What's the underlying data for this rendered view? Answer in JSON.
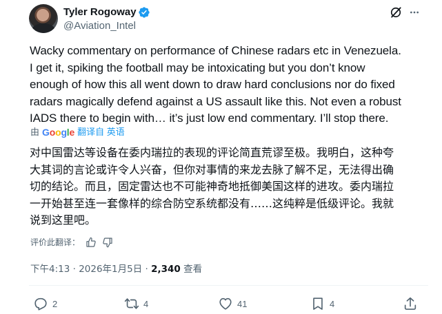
{
  "author": {
    "name": "Tyler Rogoway",
    "handle": "@Aviation_Intel",
    "verified": true,
    "verified_color": "#1d9bf0"
  },
  "tweet": {
    "lines": [
      "Wacky commentary on performance of Chinese radars etc in Venezuela.",
      "I get it, spiking the football may be intoxicating but you don’t know",
      "enough of how this all went down to draw hard conclusions nor do fixed",
      "radars magically defend against a US assault like this. Not even a robust",
      "IADS there to begin with… it’s just low end commentary. I’ll stop there."
    ]
  },
  "translation_bar": {
    "by_label": "由",
    "google": [
      "G",
      "o",
      "o",
      "g",
      "l",
      "e"
    ],
    "link_label": "翻译自 英语"
  },
  "translation": {
    "lines": [
      "对中国雷达等设备在委内瑞拉的表现的评论简直荒谬至极。我明白，这种夸",
      "大其词的言论或许令人兴奋，但你对事情的来龙去脉了解不足，无法得出确",
      "切的结论。而且，固定雷达也不可能神奇地抵御美国这样的进攻。委内瑞拉",
      "一开始甚至连一套像样的综合防空系统都没有……这纯粹是低级评论。我就",
      "说到这里吧。"
    ]
  },
  "rate": {
    "label": "评价此翻译："
  },
  "meta": {
    "time": "下午4:13",
    "separator": " · ",
    "date": "2026年1月5日",
    "views_count": "2,340",
    "views_label": "查看"
  },
  "actions": {
    "replies": "2",
    "reposts": "4",
    "likes": "41",
    "bookmarks": "4"
  },
  "colors": {
    "text": "#0f1419",
    "secondary": "#536471",
    "link": "#1d9bf0"
  }
}
